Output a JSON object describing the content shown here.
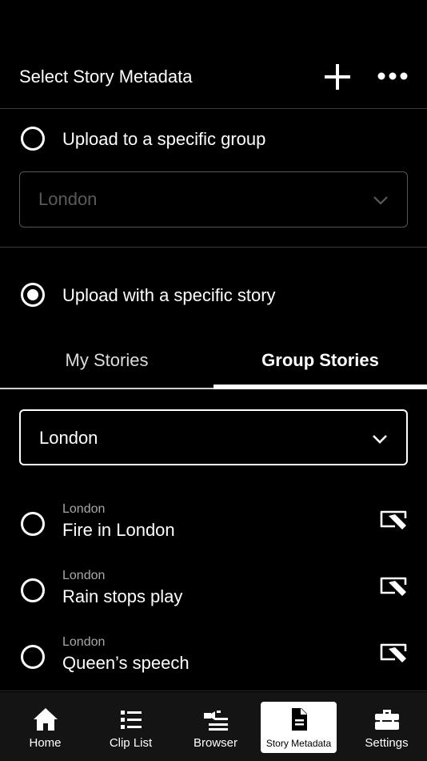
{
  "header": {
    "title": "Select Story Metadata",
    "add_icon": "plus-icon",
    "more_icon": "more-dots-icon"
  },
  "group_option": {
    "label": "Upload to a specific group",
    "selected": false,
    "select_value": "London",
    "enabled": false
  },
  "story_option": {
    "label": "Upload with a specific story",
    "selected": true
  },
  "tabs": [
    {
      "label": "My Stories",
      "active": false
    },
    {
      "label": "Group Stories",
      "active": true
    }
  ],
  "group_select": {
    "value": "London"
  },
  "stories": [
    {
      "group": "London",
      "name": "Fire in London",
      "selected": false
    },
    {
      "group": "London",
      "name": "Rain stops play",
      "selected": false
    },
    {
      "group": "London",
      "name": "Queen’s speech",
      "selected": false
    }
  ],
  "nav": [
    {
      "label": "Home",
      "icon": "home-icon",
      "active": false
    },
    {
      "label": "Clip List",
      "icon": "list-icon",
      "active": false
    },
    {
      "label": "Browser",
      "icon": "browser-icon",
      "active": false
    },
    {
      "label": "Story Metadata",
      "icon": "document-icon",
      "active": true
    },
    {
      "label": "Settings",
      "icon": "toolbox-icon",
      "active": false
    }
  ]
}
